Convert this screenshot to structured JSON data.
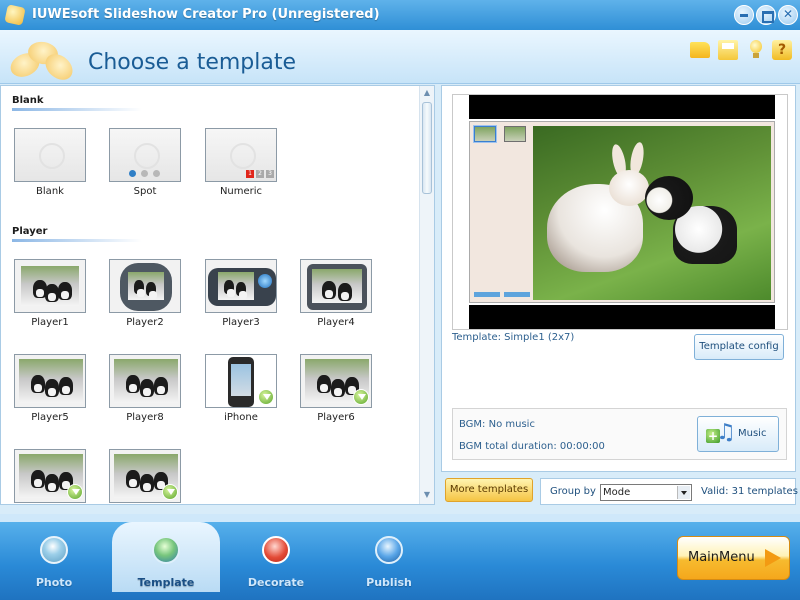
{
  "window": {
    "title": "IUWEsoft Slideshow Creator Pro (Unregistered)"
  },
  "header": {
    "title": "Choose a template",
    "tool_icons": [
      "folder-icon",
      "save-icon",
      "bulb-icon",
      "help-icon"
    ],
    "help_glyph": "?"
  },
  "templates": {
    "sections": [
      {
        "title": "Blank",
        "items": [
          {
            "label": "Blank",
            "style": "blank"
          },
          {
            "label": "Spot",
            "style": "spot"
          },
          {
            "label": "Numeric",
            "style": "numeric",
            "numbers": [
              "1",
              "2",
              "3"
            ]
          }
        ]
      },
      {
        "title": "Player",
        "items": [
          {
            "label": "Player1",
            "downloadable": false
          },
          {
            "label": "Player2",
            "downloadable": false
          },
          {
            "label": "Player3",
            "downloadable": false
          },
          {
            "label": "Player4",
            "downloadable": false
          },
          {
            "label": "Player5",
            "downloadable": false
          },
          {
            "label": "Player8",
            "downloadable": false
          },
          {
            "label": "iPhone",
            "downloadable": true
          },
          {
            "label": "Player6",
            "downloadable": true
          },
          {
            "label": "",
            "downloadable": true
          },
          {
            "label": "",
            "downloadable": true
          }
        ]
      }
    ]
  },
  "preview": {
    "template_name": "Template:  Simple1 (2x7)",
    "config_button": "Template config",
    "bgm": "BGM: No music",
    "bgm_duration": "BGM total duration: 00:00:00",
    "music_button": "Music"
  },
  "controls": {
    "more_templates": "More templates",
    "group_by_label": "Group by",
    "group_by_value": "Mode",
    "valid_text": "Valid: 31 templates"
  },
  "nav": {
    "tabs": [
      {
        "label": "Photo",
        "icon": "photo-icon",
        "active": false
      },
      {
        "label": "Template",
        "icon": "template-icon",
        "active": true
      },
      {
        "label": "Decorate",
        "icon": "decorate-icon",
        "active": false
      },
      {
        "label": "Publish",
        "icon": "publish-icon",
        "active": false
      }
    ],
    "main_menu": "MainMenu"
  },
  "colors": {
    "accent": "#2f8fd6",
    "button_gold": "#f5c444",
    "active_tab_text": "#1a4f85"
  }
}
